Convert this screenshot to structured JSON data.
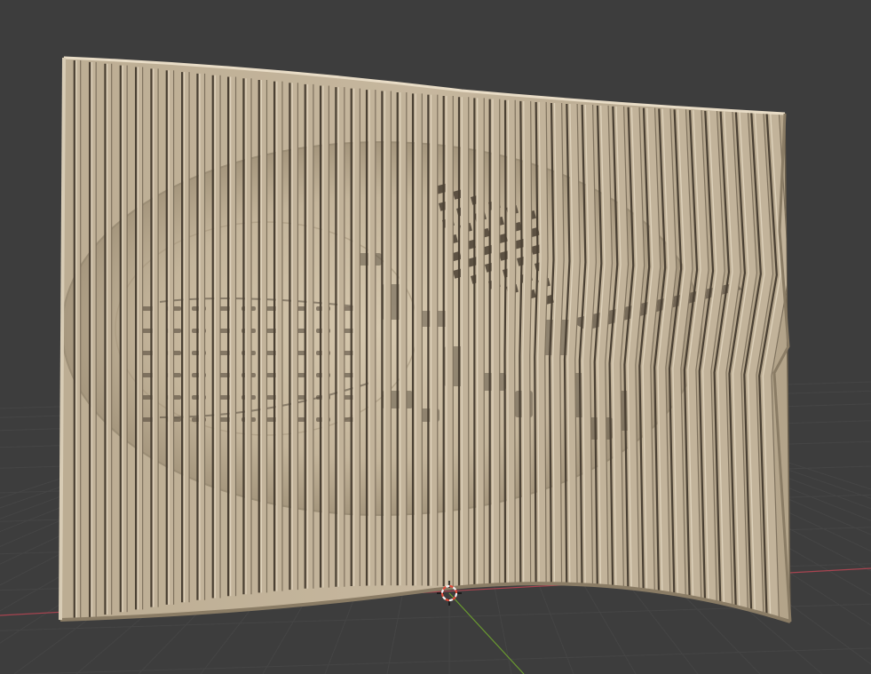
{
  "viewport": {
    "background_color": "#3d3d3d",
    "grid_color": "#454545",
    "x_axis_color": "#a84450",
    "y_axis_color": "#6a9a30"
  },
  "model": {
    "type": "sliced relief panel",
    "base_color": "#c2b39a",
    "light_color": "#e2d6c0",
    "shadow_color": "#6e624f",
    "gap_color": "#4a4033"
  },
  "cursor_3d": {
    "icon": "3d-cursor-icon",
    "ring_color_a": "#e04a3a",
    "ring_color_b": "#f2f2f2"
  }
}
